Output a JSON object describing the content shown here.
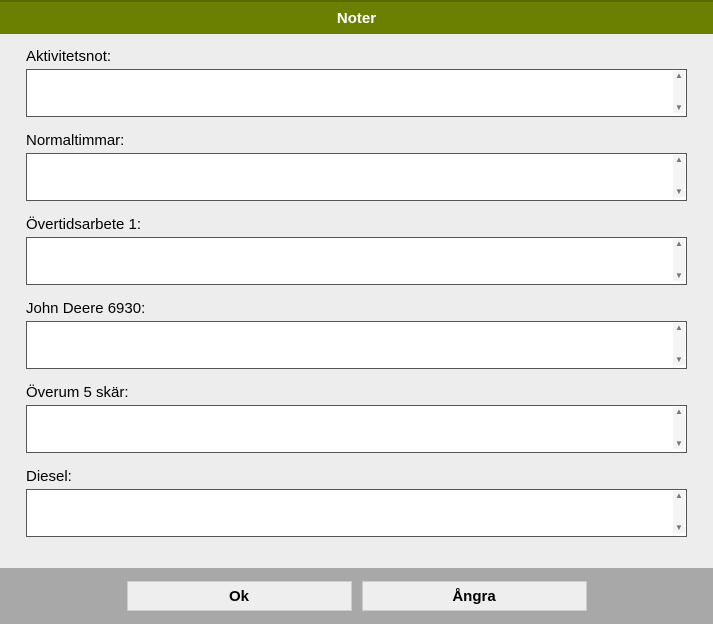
{
  "header": {
    "title": "Noter"
  },
  "fields": [
    {
      "key": "activity-note",
      "label": "Aktivitetsnot:",
      "value": ""
    },
    {
      "key": "normal-hours",
      "label": "Normaltimmar:",
      "value": ""
    },
    {
      "key": "overtime-1",
      "label": "Övertidsarbete 1:",
      "value": ""
    },
    {
      "key": "john-deere-6930",
      "label": "John Deere 6930:",
      "value": ""
    },
    {
      "key": "overum-5-skar",
      "label": "Överum 5 skär:",
      "value": ""
    },
    {
      "key": "diesel",
      "label": "Diesel:",
      "value": ""
    }
  ],
  "footer": {
    "ok_label": "Ok",
    "cancel_label": "Ångra"
  }
}
